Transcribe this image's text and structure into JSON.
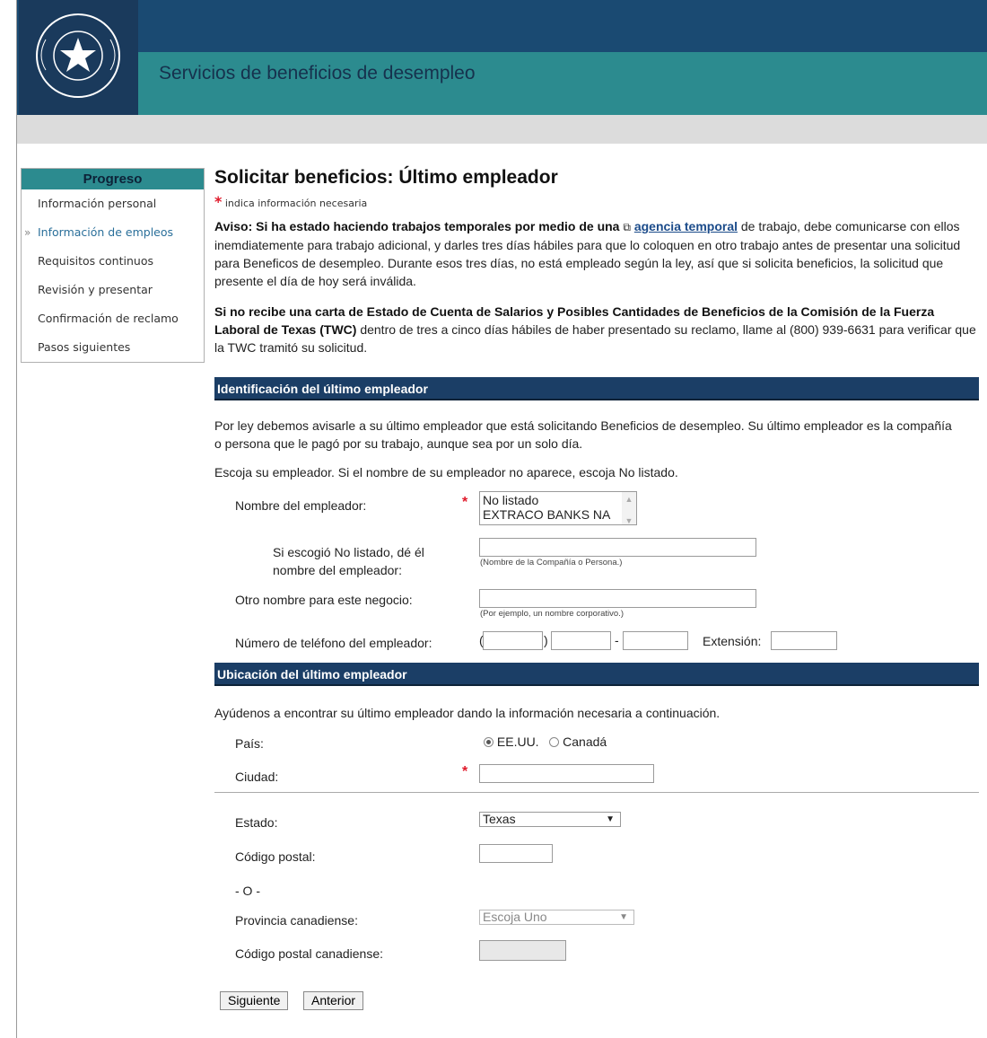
{
  "header": {
    "logo_text": "TEXAS WORKFORCE COMMISSION",
    "title": "Servicios de beneficios de desempleo"
  },
  "sidebar": {
    "title": "Progreso",
    "items": [
      {
        "label": "Información personal",
        "current": false
      },
      {
        "label": "Información de empleos",
        "current": true
      },
      {
        "label": "Requisitos continuos",
        "current": false
      },
      {
        "label": "Revisión y presentar",
        "current": false
      },
      {
        "label": "Confirmación de reclamo",
        "current": false
      },
      {
        "label": "Pasos siguientes",
        "current": false
      }
    ],
    "current_marker": "»"
  },
  "main": {
    "title": "Solicitar beneficios: Último empleador",
    "required_note": "indica información necesaria",
    "notice_bold": "Aviso: Si ha estado haciendo trabajos temporales por medio de una",
    "notice_link": "agencia temporal",
    "notice_rest": "de trabajo, debe comunicarse con ellos inemdiatemente para trabajo adicional, y darles tres días hábiles para que lo coloquen en otro trabajo antes de presentar una solicitud para Beneficos de desempleo. Durante esos tres días, no está empleado según la ley, así que si solicita beneficios, la solicitud que presente el día de hoy será inválida.",
    "info_bold": "Si no recibe una carta de Estado de Cuenta de Salarios y Posibles Cantidades de Beneficios de la Comisión de la Fuerza Laboral de Texas (TWC)",
    "info_rest": "dentro de tres a cinco días hábiles de haber presentado su reclamo, llame al (800) 939-6631 para verificar que la TWC tramitó su solicitud."
  },
  "employer_section": {
    "heading": "Identificación del último empleador",
    "intro": "Por ley debemos avisarle a su último empleador que está solicitando Beneficios de desempleo. Su último empleador es la compañía o persona que le pagó por su trabajo, aunque sea por un solo día.",
    "choose": "Escoja su empleador. Si el nombre de su empleador no aparece, escoja No listado.",
    "employer_label": "Nombre del empleador:",
    "employer_options": [
      "No listado",
      "EXTRACO BANKS NA"
    ],
    "unlisted_label_1": "Si escogió No listado, dé él",
    "unlisted_label_2": "nombre del empleador:",
    "unlisted_hint": "(Nombre de la Compañía o Persona.)",
    "unlisted_value": "",
    "other_name_label": "Otro nombre para este negocio:",
    "other_name_hint": "(Por ejemplo, un nombre corporativo.)",
    "other_name_value": "",
    "phone_label": "Número de teléfono del empleador:",
    "phone_open": "(",
    "phone_close": ")",
    "phone_dash": "-",
    "extension_label": "Extensión:"
  },
  "location_section": {
    "heading": "Ubicación del último empleador",
    "intro": "Ayúdenos a encontrar su último empleador dando la información necesaria a continuación.",
    "country_label": "País:",
    "country_options": [
      "EE.UU.",
      "Canadá"
    ],
    "country_selected": "EE.UU.",
    "city_label": "Ciudad:",
    "city_value": "",
    "state_label": "Estado:",
    "state_value": "Texas",
    "zip_label": "Código postal:",
    "zip_value": "",
    "or_text": "- O -",
    "province_label": "Provincia canadiense:",
    "province_value": "Escoja Uno",
    "ca_postal_label": "Código postal canadiense:",
    "ca_postal_value": ""
  },
  "buttons": {
    "next": "Siguiente",
    "back": "Anterior"
  },
  "colors": {
    "header_navy": "#1a4a72",
    "header_teal": "#2c8b8f",
    "section_navy": "#1b3e66",
    "required_red": "#e0192a",
    "link_blue": "#1b4b8a"
  }
}
